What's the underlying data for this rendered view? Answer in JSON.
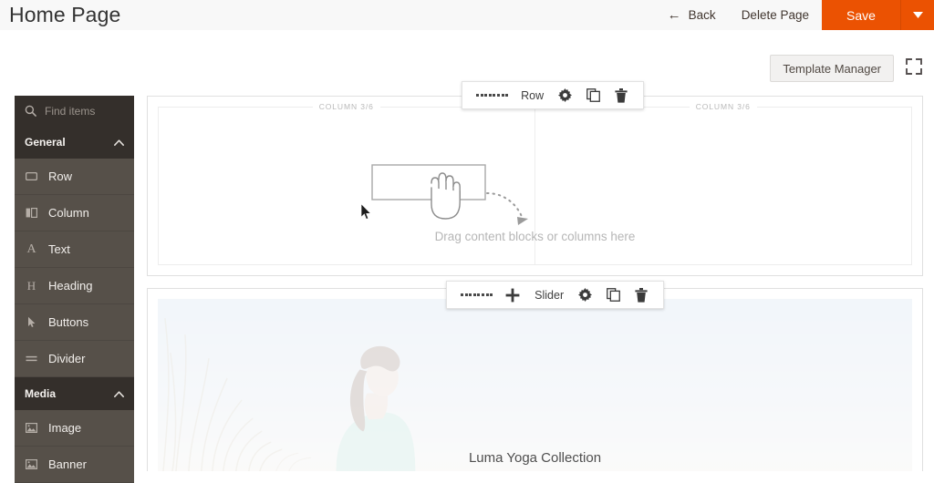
{
  "header": {
    "title": "Home Page",
    "back_label": "Back",
    "back_icon": "arrow-left-icon",
    "delete_page_label": "Delete Page",
    "save_label": "Save",
    "save_caret_icon": "caret-down-icon",
    "accent_color": "#eb5202",
    "background_color": "#f8f8f8"
  },
  "subbar": {
    "template_manager_label": "Template Manager",
    "fullscreen_icon": "fullscreen-expand-icon"
  },
  "sidebar": {
    "search": {
      "placeholder": "Find items",
      "value": "",
      "icon": "search-icon"
    },
    "groups": [
      {
        "label": "General",
        "collapse_icon": "chevron-up-icon",
        "items": [
          {
            "label": "Row",
            "icon": "row-icon"
          },
          {
            "label": "Column",
            "icon": "column-icon"
          },
          {
            "label": "Text",
            "icon": "text-icon"
          },
          {
            "label": "Heading",
            "icon": "heading-icon"
          },
          {
            "label": "Buttons",
            "icon": "buttons-cursor-icon"
          },
          {
            "label": "Divider",
            "icon": "divider-icon"
          }
        ]
      },
      {
        "label": "Media",
        "collapse_icon": "chevron-up-icon",
        "items": [
          {
            "label": "Image",
            "icon": "image-icon"
          },
          {
            "label": "Banner",
            "icon": "banner-icon"
          }
        ]
      }
    ]
  },
  "canvas": {
    "row1": {
      "column_left_label": "COLUMN 3/6",
      "column_right_label": "COLUMN 3/6",
      "drop_hint": "Drag content blocks or columns here"
    },
    "row2": {
      "banner_caption": "Luma Yoga Collection"
    }
  },
  "toolbars": {
    "row": {
      "drag_icon": "drag-grip-icon",
      "label": "Row",
      "settings_icon": "gear-icon",
      "duplicate_icon": "copy-icon",
      "delete_icon": "trash-icon"
    },
    "slider": {
      "drag_icon": "drag-grip-icon",
      "add_icon": "plus-icon",
      "label": "Slider",
      "settings_icon": "gear-icon",
      "duplicate_icon": "copy-icon",
      "delete_icon": "trash-icon"
    }
  }
}
